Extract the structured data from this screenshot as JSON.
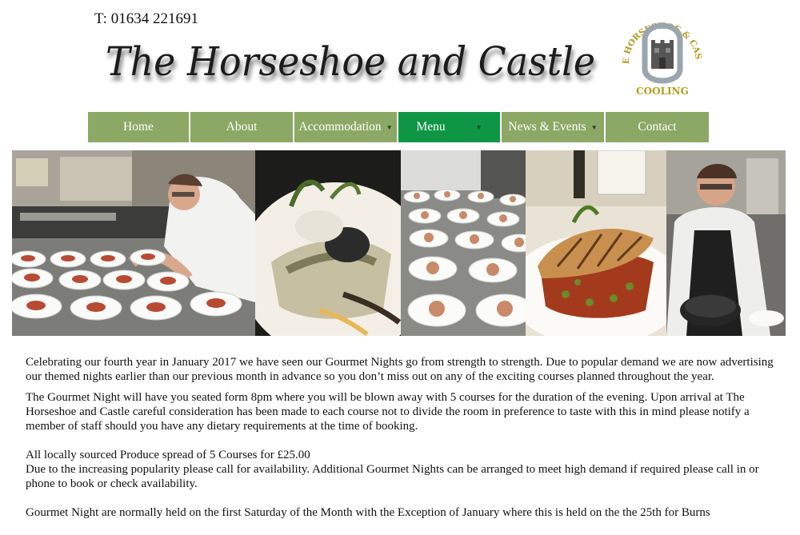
{
  "header": {
    "phone": "T: 01634 221691",
    "site_title": "The Horseshoe and Castle",
    "logo_text_top": "THE HORSESHOE & CASTLE",
    "logo_text_bottom": "COOLING"
  },
  "nav": {
    "items": [
      {
        "label": "Home",
        "has_dropdown": false,
        "active": false
      },
      {
        "label": "About",
        "has_dropdown": false,
        "active": false
      },
      {
        "label": "Accommodation",
        "has_dropdown": true,
        "active": false
      },
      {
        "label": "Menu",
        "has_dropdown": true,
        "active": true
      },
      {
        "label": "News & Events",
        "has_dropdown": true,
        "active": false
      },
      {
        "label": "Contact",
        "has_dropdown": false,
        "active": false
      }
    ]
  },
  "colors": {
    "nav_bg": "#8ca865",
    "nav_active": "#0f9645",
    "logo_gold": "#b79a1a"
  },
  "content": {
    "p1": "Celebrating our fourth year in January 2017 we have seen our Gourmet Nights go from strength to strength. Due to popular demand we are now advertising our themed nights earlier than our previous month in advance so you don’t miss out on any of the exciting courses planned throughout the year.",
    "p2": "The Gourmet Night will have you seated form 8pm where you will be blown away with 5 courses for the duration of the evening. Upon arrival at The Horseshoe and Castle careful consideration has been made to each course not to divide the room in preference to taste with this in mind please notify a member of staff should you have any dietary requirements at the time of booking.",
    "p3": "All locally sourced Produce spread of 5 Courses for £25.00",
    "p4": "Due to the increasing popularity please call for availability. Additional Gourmet Nights can be arranged to meet high demand if required please call in or phone to book or check availability.",
    "p5": "Gourmet Night are normally held on the first Saturday of the Month with the Exception of January where this is held on the the 25th for Burns"
  }
}
